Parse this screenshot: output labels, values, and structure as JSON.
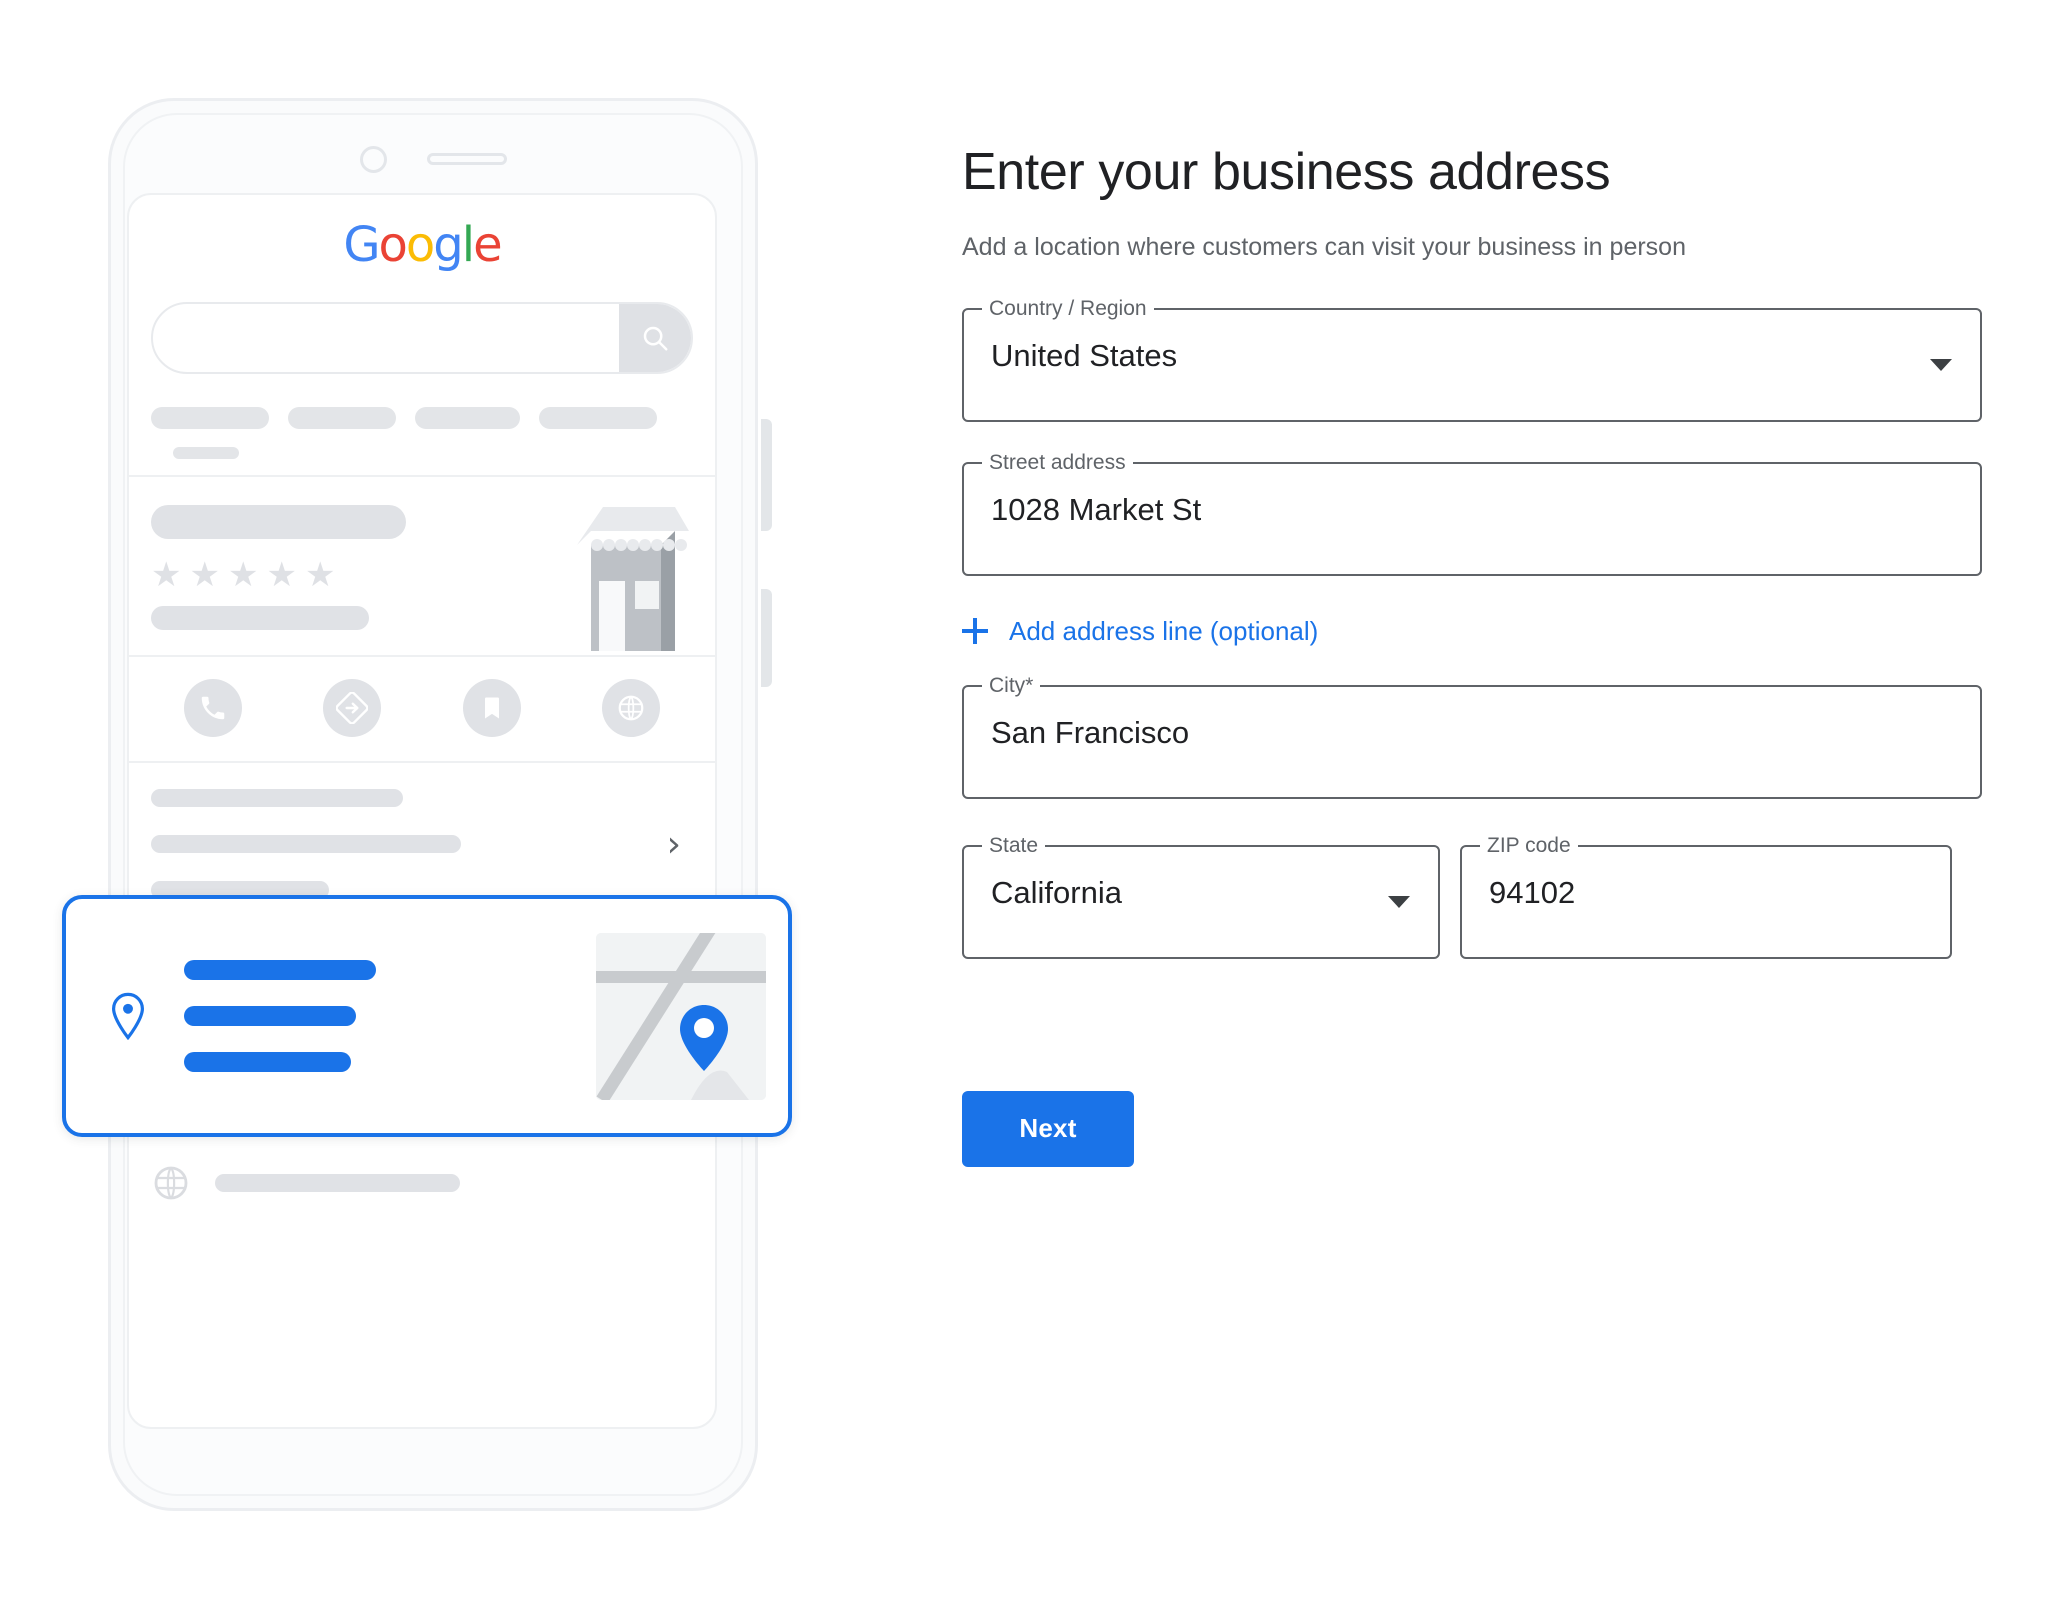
{
  "form": {
    "title": "Enter your business address",
    "subtitle": "Add a location where customers can visit your business in person",
    "fields": {
      "country": {
        "label": "Country / Region",
        "value": "United States",
        "type": "select"
      },
      "street": {
        "label": "Street address",
        "value": "1028 Market St",
        "type": "text"
      },
      "city": {
        "label": "City*",
        "value": "San Francisco",
        "type": "text"
      },
      "state": {
        "label": "State",
        "value": "California",
        "type": "select"
      },
      "zip": {
        "label": "ZIP code",
        "value": "94102",
        "type": "text"
      }
    },
    "add_address_line": "Add address line (optional)",
    "next_label": "Next"
  },
  "colors": {
    "accent_blue": "#1A73E8",
    "text_primary": "#202124",
    "text_secondary": "#5F6368",
    "field_border": "#5F6368",
    "placeholder_grey": "#E0E2E6"
  },
  "illustration": {
    "logo": {
      "letters": [
        "G",
        "o",
        "o",
        "g",
        "l",
        "e"
      ]
    },
    "icons": {
      "search": "search-icon",
      "call": "call-icon",
      "directions": "directions-icon",
      "save": "bookmark-icon",
      "website": "globe-icon",
      "hours": "clock-icon",
      "phone": "phone-icon",
      "location": "location-pin-icon",
      "chevron": "chevron-right-icon",
      "map_pin": "map-pin-icon"
    },
    "stars": [
      "★",
      "★",
      "★",
      "★",
      "★"
    ],
    "chevron_glyph": "›"
  }
}
